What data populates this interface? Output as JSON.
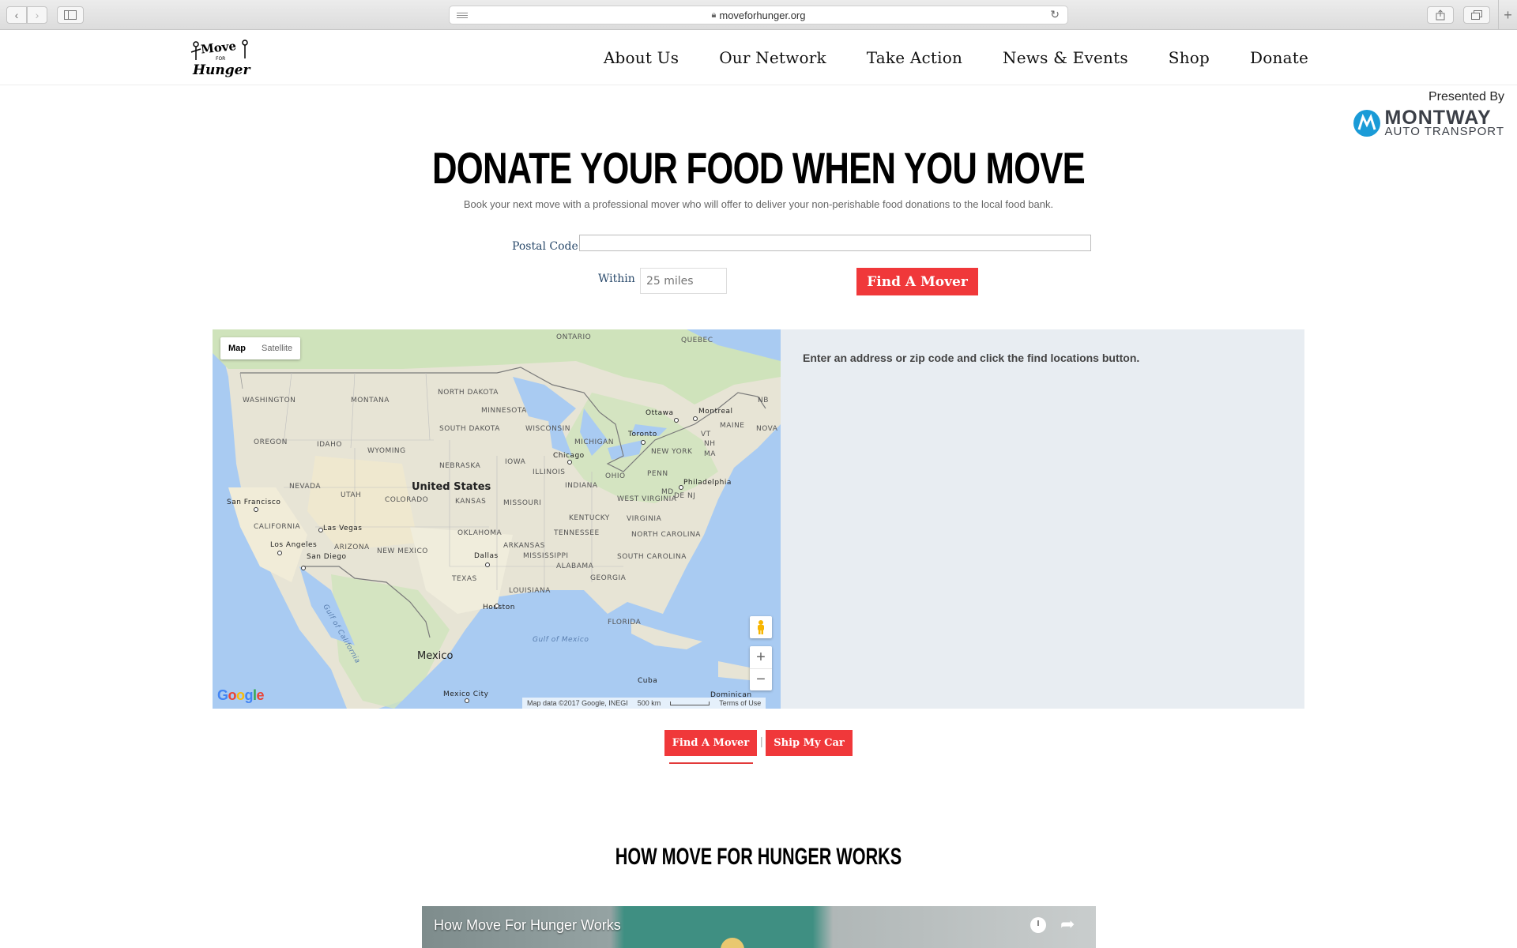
{
  "browser": {
    "url": "moveforhunger.org"
  },
  "nav": {
    "items": [
      "About Us",
      "Our Network",
      "Take Action",
      "News & Events",
      "Shop",
      "Donate"
    ]
  },
  "sponsor": {
    "presented_by": "Presented By",
    "brand_name": "MONTWAY",
    "brand_sub": "AUTO TRANSPORT"
  },
  "hero": {
    "title": "Donate Your Food When You Move",
    "subtitle": "Book your next move with a professional mover who will offer to deliver your non-perishable food donations to the local food bank."
  },
  "form": {
    "postal_label": "Postal Code",
    "postal_value": "",
    "within_label": "Within",
    "within_value": "25 miles",
    "find_button": "Find A Mover"
  },
  "map": {
    "type_map": "Map",
    "type_satellite": "Satellite",
    "attribution": "Map data ©2017 Google, INEGI",
    "scale": "500 km",
    "terms": "Terms of Use",
    "google_logo": "Google",
    "labels": {
      "ontario": "ONTARIO",
      "quebec": "QUEBEC",
      "washington": "WASHINGTON",
      "montana": "MONTANA",
      "north_dakota": "NORTH DAKOTA",
      "minnesota": "MINNESOTA",
      "ottawa": "Ottawa",
      "montreal": "Montreal",
      "nb": "NB",
      "maine": "MAINE",
      "nova": "NOVA",
      "oregon": "OREGON",
      "idaho": "IDAHO",
      "south_dakota": "SOUTH DAKOTA",
      "wisconsin": "WISCONSIN",
      "michigan": "MICHIGAN",
      "toronto": "Toronto",
      "vt": "VT",
      "nh": "NH",
      "wyoming": "WYOMING",
      "iowa": "IOWA",
      "chicago": "Chicago",
      "new_york": "NEW YORK",
      "ma": "MA",
      "nebraska": "NEBRASKA",
      "illinois": "ILLINOIS",
      "ohio": "OHIO",
      "penn": "PENN",
      "philadelphia": "Philadelphia",
      "nevada": "NEVADA",
      "utah": "UTAH",
      "united_states": "United States",
      "colorado": "COLORADO",
      "kansas": "KANSAS",
      "missouri": "MISSOURI",
      "indiana": "INDIANA",
      "md": "MD",
      "dej": "DE NJ",
      "san_francisco": "San Francisco",
      "west_virginia": "WEST VIRGINIA",
      "kentucky": "KENTUCKY",
      "virginia": "VIRGINIA",
      "california": "CALIFORNIA",
      "las_vegas": "Las Vegas",
      "oklahoma": "OKLAHOMA",
      "tennessee": "TENNESSEE",
      "north_carolina": "NORTH CAROLINA",
      "los_angeles": "Los Angeles",
      "arizona": "ARIZONA",
      "san_diego": "San Diego",
      "new_mexico": "NEW MEXICO",
      "dallas": "Dallas",
      "arkansas": "ARKANSAS",
      "mississippi": "MISSISSIPPI",
      "alabama": "ALABAMA",
      "south_carolina": "SOUTH CAROLINA",
      "georgia": "GEORGIA",
      "texas": "TEXAS",
      "louisiana": "LOUISIANA",
      "houston": "Houston",
      "florida": "FLORIDA",
      "gulf_california": "Gulf of California",
      "gulf_mexico": "Gulf of Mexico",
      "mexico": "Mexico",
      "cuba": "Cuba",
      "mexico_city": "Mexico City",
      "dominican": "Dominican"
    }
  },
  "info_panel": {
    "message": "Enter an address or zip code and click the find locations button."
  },
  "bottom_buttons": {
    "find": "Find A Mover",
    "separator": "|",
    "ship": "Ship My Car"
  },
  "how_it_works": {
    "title": "How Move For Hunger Works",
    "video_title": "How Move For Hunger Works"
  },
  "colors": {
    "accent_red": "#f0383a",
    "label_blue": "#2a4a6b",
    "panel_bg": "#e8edf2"
  }
}
